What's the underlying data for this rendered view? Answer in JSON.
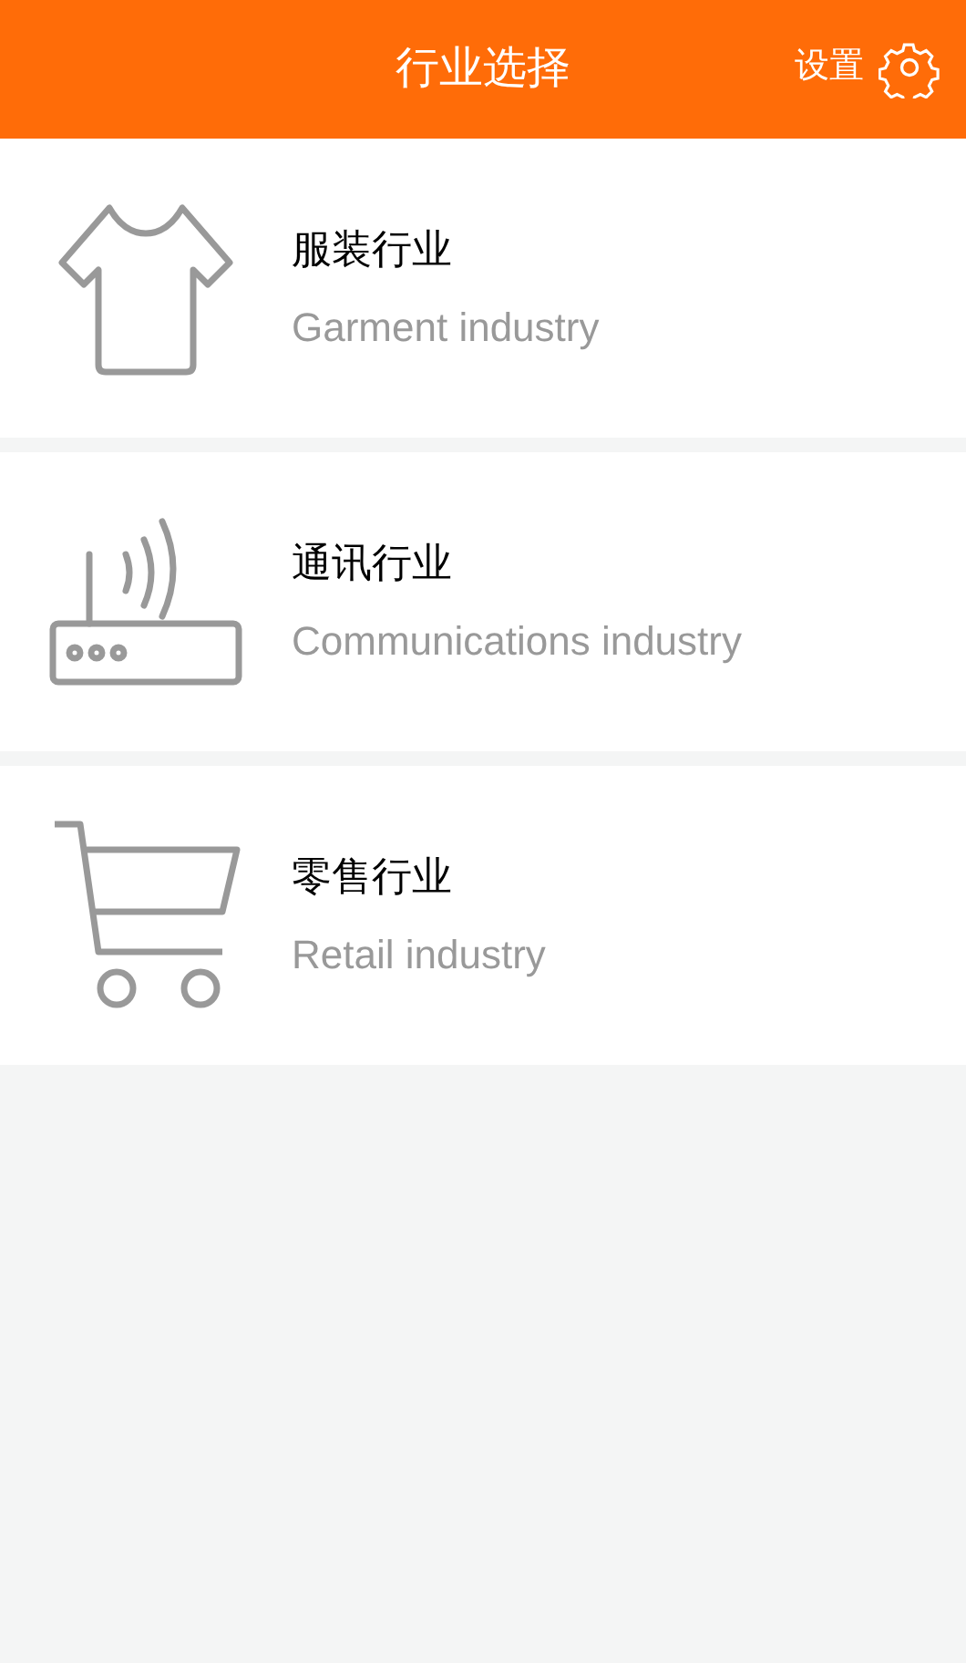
{
  "header": {
    "title": "行业选择",
    "settings_label": "设置"
  },
  "industries": [
    {
      "kind": "garment",
      "name": "服装行业",
      "subtitle": "Garment industry"
    },
    {
      "kind": "communications",
      "name": "通讯行业",
      "subtitle": "Communications industry"
    },
    {
      "kind": "retail",
      "name": "零售行业",
      "subtitle": "Retail industry"
    }
  ]
}
